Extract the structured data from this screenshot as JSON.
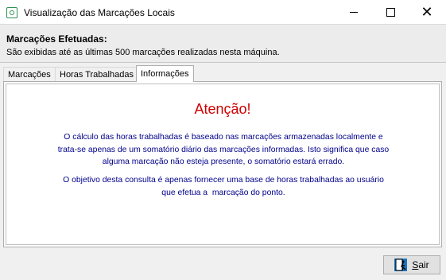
{
  "window": {
    "title": "Visualização das Marcações Locais",
    "minimize_glyph": "—",
    "close_glyph": "✕"
  },
  "header": {
    "title": "Marcações Efetuadas:",
    "subtitle": "São exibidas até as últimas 500 marcações realizadas nesta máquina."
  },
  "tabs": [
    {
      "label": "Marcações",
      "active": false
    },
    {
      "label": "Horas Trabalhadas",
      "active": false
    },
    {
      "label": "Informações",
      "active": true
    }
  ],
  "info": {
    "heading": "Atenção!",
    "paragraph1": [
      "O cálculo das horas trabalhadas é baseado nas marcações armazenadas localmente e",
      "trata-se apenas de um somatório diário das marcações informadas. Isto significa que caso",
      "alguma marcação não esteja presente, o somatório estará errado."
    ],
    "paragraph2": [
      "O objetivo desta consulta é apenas fornecer uma base de horas trabalhadas ao usuário",
      "que efetua a  marcação do ponto."
    ]
  },
  "footer": {
    "exit_button": {
      "mnemonic": "S",
      "rest": "air",
      "icon": "exit-door-icon"
    }
  },
  "colors": {
    "heading": "#d00000",
    "body_text": "#00008b",
    "icon_accent": "#2f8f55"
  }
}
